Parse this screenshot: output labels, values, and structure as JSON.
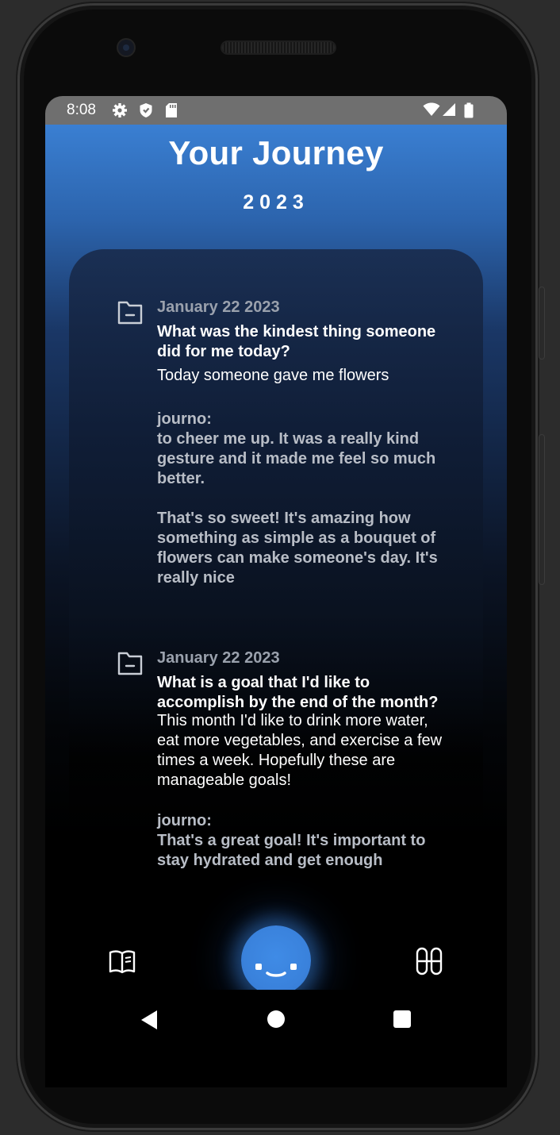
{
  "status_bar": {
    "time": "8:08",
    "icons": [
      "gear-icon",
      "shield-icon",
      "sd-card-icon",
      "wifi-icon",
      "signal-icon",
      "battery-icon"
    ]
  },
  "header": {
    "title": "Your Journey",
    "year": "2023"
  },
  "entries": [
    {
      "date": "January 22 2023",
      "question": "What was the kindest thing someone did for me today?",
      "answer": "Today someone gave me flowers",
      "ai_label": "journo:",
      "ai_text": "to cheer me up. It was a really kind gesture and it made me feel so much better.\n\nThat's so sweet! It's amazing how something as simple as a bouquet of flowers can make someone's day. It's really nice"
    },
    {
      "date": "January 22 2023",
      "question": "What is a goal that I'd like to accomplish by the end of the month?",
      "answer": "This month I'd like to drink more water, eat more vegetables, and exercise a few times a week. Hopefully these are manageable goals!",
      "ai_label": "journo:",
      "ai_text": "That's a great goal! It's important to stay hydrated and get enough"
    }
  ],
  "bottom_nav": {
    "left_icon": "book-icon",
    "center_icon": "face-icon",
    "right_icon": "grid-icon"
  },
  "colors": {
    "header_blue": "#3a7fd2",
    "accent_blue": "#3a82dc",
    "status_bar": "#6f6f6f",
    "date_text": "#9aa1ad",
    "ai_text": "#b8bdc6"
  }
}
